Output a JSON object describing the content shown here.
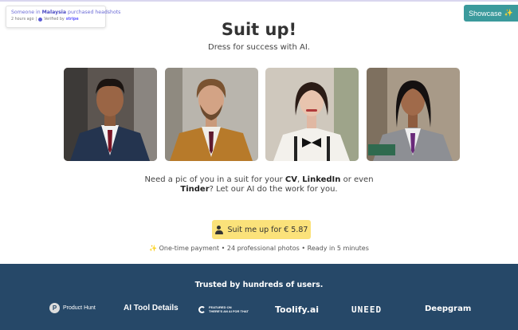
{
  "toast": {
    "prefix": "Someone in ",
    "country": "Malaysia",
    "suffix": " purchased headshots",
    "time": "2 hours ago",
    "separator": "|",
    "verified": "Verified by",
    "provider": "stripe"
  },
  "showcase": {
    "label": "Showcase",
    "emoji": "✨"
  },
  "hero": {
    "title": "Suit up!",
    "subtitle": "Dress for success with AI."
  },
  "photos": [
    {
      "name": "photo-man-navy-suit",
      "icon": "portrait"
    },
    {
      "name": "photo-man-mustard-suit",
      "icon": "portrait"
    },
    {
      "name": "photo-woman-bowtie",
      "icon": "portrait"
    },
    {
      "name": "photo-woman-grey-suit",
      "icon": "portrait"
    }
  ],
  "description": {
    "p1": "Need a pic of you in a suit for your ",
    "cv": "CV",
    "p2": ", ",
    "linkedin": "LinkedIn",
    "p3": " or even ",
    "tinder": "Tinder",
    "p4": "? Let our AI do the work for you."
  },
  "cta": {
    "label": "Suit me up for € 5.87",
    "icon": "user-icon"
  },
  "meta": {
    "emoji": "✨",
    "text": " One-time payment • 24 professional photos • Ready in 5 minutes"
  },
  "footer": {
    "trusted": "Trusted by hundreds of users.",
    "logos": {
      "product_hunt_letter": "P",
      "product_hunt": "Product Hunt",
      "ai_tool_details": "AI Tool Details",
      "taaft_line1": "FEATURED ON",
      "taaft_line2": "THERE'S AN AI FOR THAT",
      "toolify": "Toolify.ai",
      "uneed": "UNEED",
      "deepgram": "Deepgram"
    }
  },
  "colors": {
    "showcase": "#3b9a9c",
    "cta": "#fbe27a",
    "footer": "#264868"
  }
}
